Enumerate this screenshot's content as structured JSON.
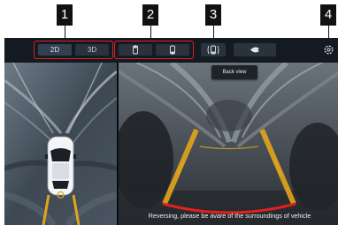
{
  "callouts": [
    "1",
    "2",
    "3",
    "4"
  ],
  "view_mode": {
    "options": [
      "2D",
      "3D"
    ],
    "selected": "2D"
  },
  "camera_buttons": [
    "front-camera-icon",
    "rear-camera-icon"
  ],
  "back_view_button": {
    "icon": "back-view-icon",
    "tooltip": "Back view"
  },
  "ghost_view_button": {
    "icon": "ghost-view-icon"
  },
  "settings_button": {
    "icon": "gear-icon"
  },
  "rear_view": {
    "message": "Reversing, please be avare of the surroundings of vehicle"
  },
  "colors": {
    "highlight": "#e02020",
    "guide_line": "#e3a41c",
    "stop_line": "#e02020",
    "screen_bg": "#0f141a"
  }
}
